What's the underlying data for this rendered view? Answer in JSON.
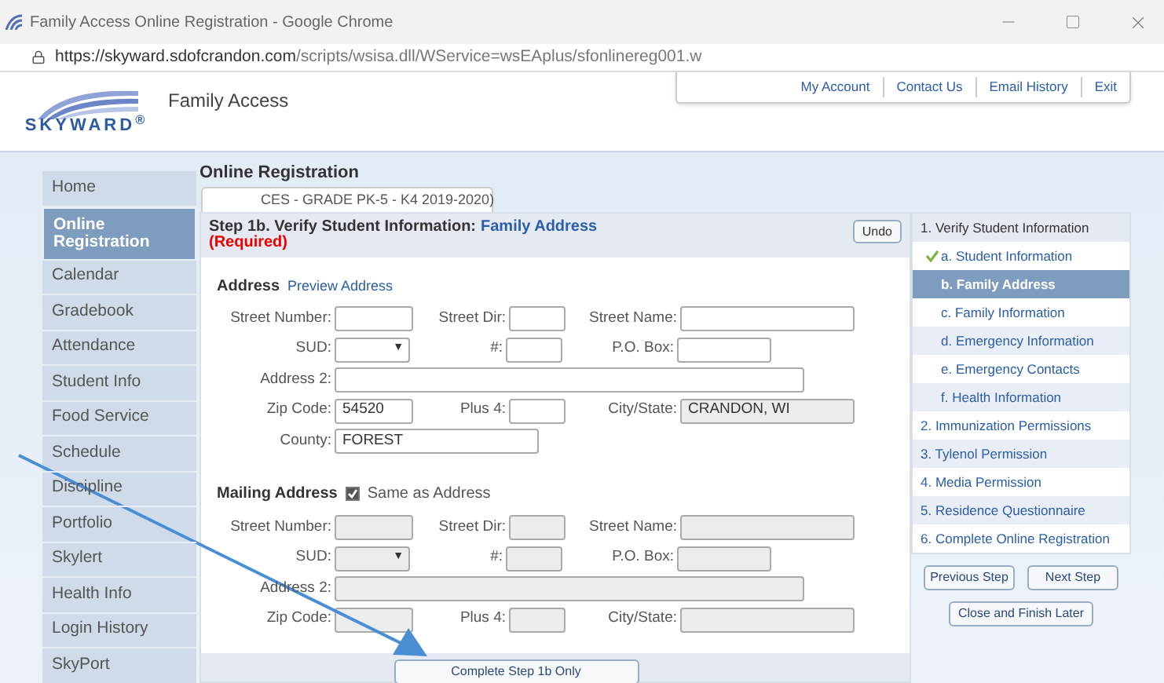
{
  "window": {
    "title": "Family Access Online Registration - Google Chrome",
    "url_host": "https://skyward.sdofcrandon.com",
    "url_path": "/scripts/wsisa.dll/WService=wsEAplus/sfonlinereg001.w"
  },
  "header": {
    "logo_text": "SKYWARD$^{®}$",
    "app_name": "Family Access",
    "links": [
      "My Account",
      "Contact Us",
      "Email History",
      "Exit"
    ]
  },
  "sidebar": {
    "items": [
      {
        "label": "Home",
        "selected": false
      },
      {
        "label": "Online Registration",
        "selected": true
      },
      {
        "label": "Calendar",
        "selected": false
      },
      {
        "label": "Gradebook",
        "selected": false
      },
      {
        "label": "Attendance",
        "selected": false
      },
      {
        "label": "Student Info",
        "selected": false
      },
      {
        "label": "Food Service",
        "selected": false
      },
      {
        "label": "Schedule",
        "selected": false
      },
      {
        "label": "Discipline",
        "selected": false
      },
      {
        "label": "Portfolio",
        "selected": false
      },
      {
        "label": "Skylert",
        "selected": false
      },
      {
        "label": "Health Info",
        "selected": false
      },
      {
        "label": "Login History",
        "selected": false
      },
      {
        "label": "SkyPort",
        "selected": false
      }
    ]
  },
  "page_title": "Online Registration",
  "tab": {
    "label": "CES - GRADE PK-5 - K4 2019-2020)"
  },
  "step": {
    "title": "Step 1b. Verify Student Information:",
    "subtitle": "Family Address",
    "required": "(Required)",
    "undo": "Undo"
  },
  "address": {
    "title": "Address",
    "link": "Preview Address",
    "rows": [
      [
        {
          "label": "Street Number:",
          "kind": "text",
          "disabled": false
        },
        {
          "label": "Street Dir:",
          "kind": "text",
          "disabled": false
        },
        {
          "label": "Street Name:",
          "kind": "text",
          "disabled": false
        }
      ],
      [
        {
          "label": "SUD:",
          "kind": "select",
          "arrow": "▼",
          "disabled": false
        },
        {
          "label": "#:",
          "kind": "text",
          "disabled": false
        },
        {
          "label": "P.O. Box:",
          "kind": "text",
          "disabled": false
        }
      ],
      [
        {
          "label": "Address 2:",
          "kind": "text",
          "disabled": false
        }
      ],
      [
        {
          "label": "Zip Code:",
          "value": "54520",
          "kind": "text",
          "disabled": false
        },
        {
          "label": "Plus 4:",
          "kind": "text",
          "disabled": false
        },
        {
          "label": "City/State:",
          "value": "CRANDON, WI",
          "kind": "text",
          "disabled": true
        }
      ],
      [
        {
          "label": "County:",
          "value": "FOREST",
          "kind": "text",
          "disabled": false
        }
      ]
    ]
  },
  "mailing": {
    "title": "Mailing Address",
    "same_as": {
      "label": "Same as Address",
      "checked": true
    },
    "rows": [
      [
        {
          "label": "Street Number:",
          "kind": "text",
          "disabled": true
        },
        {
          "label": "Street Dir:",
          "kind": "text",
          "disabled": true
        },
        {
          "label": "Street Name:",
          "kind": "text",
          "disabled": true
        }
      ],
      [
        {
          "label": "SUD:",
          "kind": "select",
          "arrow": "▼",
          "disabled": true
        },
        {
          "label": "#:",
          "kind": "text",
          "disabled": true
        },
        {
          "label": "P.O. Box:",
          "kind": "text",
          "disabled": true
        }
      ],
      [
        {
          "label": "Address 2:",
          "kind": "text",
          "disabled": true
        }
      ],
      [
        {
          "label": "Zip Code:",
          "kind": "text",
          "disabled": true
        },
        {
          "label": "Plus 4:",
          "kind": "text",
          "disabled": true
        },
        {
          "label": "City/State:",
          "kind": "text",
          "disabled": true
        }
      ]
    ]
  },
  "complete_button": "Complete Step 1b Only",
  "steps": [
    {
      "label": "1. Verify Student Information",
      "kind": "header",
      "selected": false,
      "done": false
    },
    {
      "label": "a. Student Information",
      "kind": "sub",
      "selected": false,
      "done": true
    },
    {
      "label": "b. Family Address",
      "kind": "sub",
      "selected": true,
      "done": false
    },
    {
      "label": "c. Family Information",
      "kind": "sub",
      "selected": false,
      "done": false
    },
    {
      "label": "d. Emergency Information",
      "kind": "sub",
      "selected": false,
      "done": false
    },
    {
      "label": "e. Emergency Contacts",
      "kind": "sub",
      "selected": false,
      "done": false
    },
    {
      "label": "f. Health Information",
      "kind": "sub",
      "selected": false,
      "done": false
    },
    {
      "label": "2. Immunization Permissions",
      "kind": "main",
      "selected": false,
      "done": false
    },
    {
      "label": "3. Tylenol Permission",
      "kind": "main",
      "selected": false,
      "done": false
    },
    {
      "label": "4. Media Permission",
      "kind": "main",
      "selected": false,
      "done": false
    },
    {
      "label": "5. Residence Questionnaire",
      "kind": "main",
      "selected": false,
      "done": false
    },
    {
      "label": "6. Complete Online Registration",
      "kind": "main",
      "selected": false,
      "done": false
    }
  ],
  "nav_buttons": [
    "Previous Step",
    "Next Step",
    "Close and Finish Later"
  ]
}
